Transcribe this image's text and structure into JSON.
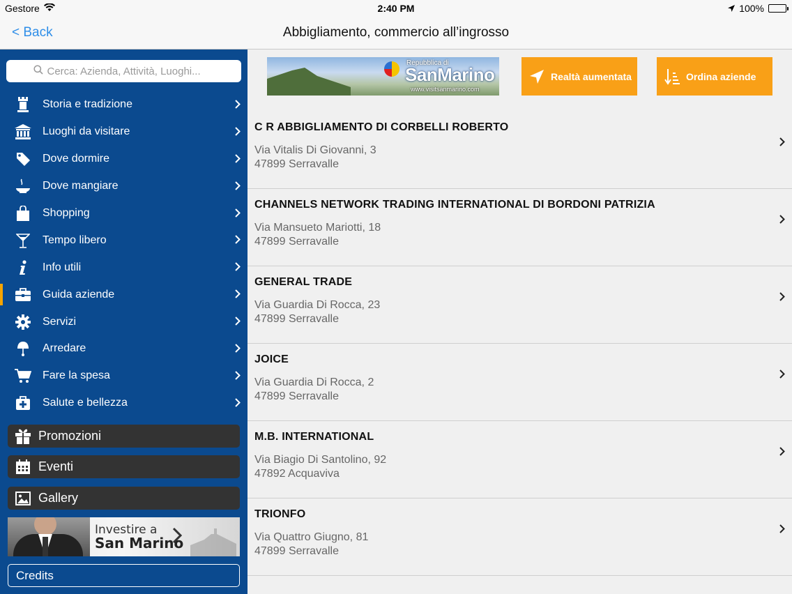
{
  "status_bar": {
    "carrier": "Gestore",
    "time": "2:40 PM",
    "battery": "100%"
  },
  "nav": {
    "back": "< Back",
    "title": "Abbigliamento, commercio all’ingrosso"
  },
  "sidebar": {
    "search_placeholder": "Cerca: Azienda, Attività, Luoghi...",
    "items": [
      {
        "label": "Storia e tradizione",
        "icon": "tower-icon"
      },
      {
        "label": "Luoghi da visitare",
        "icon": "museum-icon"
      },
      {
        "label": "Dove dormire",
        "icon": "tag-icon"
      },
      {
        "label": "Dove mangiare",
        "icon": "food-icon"
      },
      {
        "label": "Shopping",
        "icon": "shopping-bag-icon"
      },
      {
        "label": "Tempo libero",
        "icon": "cocktail-icon"
      },
      {
        "label": "Info utili",
        "icon": "info-icon"
      },
      {
        "label": "Guida aziende",
        "icon": "briefcase-icon"
      },
      {
        "label": "Servizi",
        "icon": "gear-icon"
      },
      {
        "label": "Arredare",
        "icon": "lamp-icon"
      },
      {
        "label": "Fare la spesa",
        "icon": "cart-icon"
      },
      {
        "label": "Salute e bellezza",
        "icon": "medical-icon"
      }
    ],
    "buttons": {
      "promozioni": "Promozioni",
      "eventi": "Eventi",
      "gallery": "Gallery"
    },
    "invest_banner": {
      "line1": "Investire a",
      "line2": "San Marino"
    },
    "credits": "Credits"
  },
  "main": {
    "banner": {
      "small": "Repubblica di",
      "name": "SanMarino",
      "url": "www.visitsanmarino.com"
    },
    "btn_ar": "Realtà aumentata",
    "btn_order": "Ordina aziende",
    "companies": [
      {
        "name": "C R ABBIGLIAMENTO DI CORBELLI ROBERTO",
        "address": "Via Vitalis Di Giovanni, 3",
        "city": "47899 Serravalle"
      },
      {
        "name": "CHANNELS NETWORK TRADING INTERNATIONAL DI BORDONI PATRIZIA",
        "address": "Via Mansueto Mariotti, 18",
        "city": "47899 Serravalle"
      },
      {
        "name": "GENERAL TRADE",
        "address": "Via Guardia Di Rocca, 23",
        "city": "47899 Serravalle"
      },
      {
        "name": "JOICE",
        "address": "Via Guardia Di Rocca, 2",
        "city": "47899 Serravalle"
      },
      {
        "name": "M.B. INTERNATIONAL",
        "address": "Via Biagio Di Santolino, 92",
        "city": "47892 Acquaviva"
      },
      {
        "name": "TRIONFO",
        "address": "Via Quattro Giugno, 81",
        "city": "47899 Serravalle"
      }
    ]
  },
  "colors": {
    "sidebar": "#0b4a8f",
    "accent": "#f9a017",
    "active_marker": "#f5a400",
    "link": "#2f8ee8"
  }
}
